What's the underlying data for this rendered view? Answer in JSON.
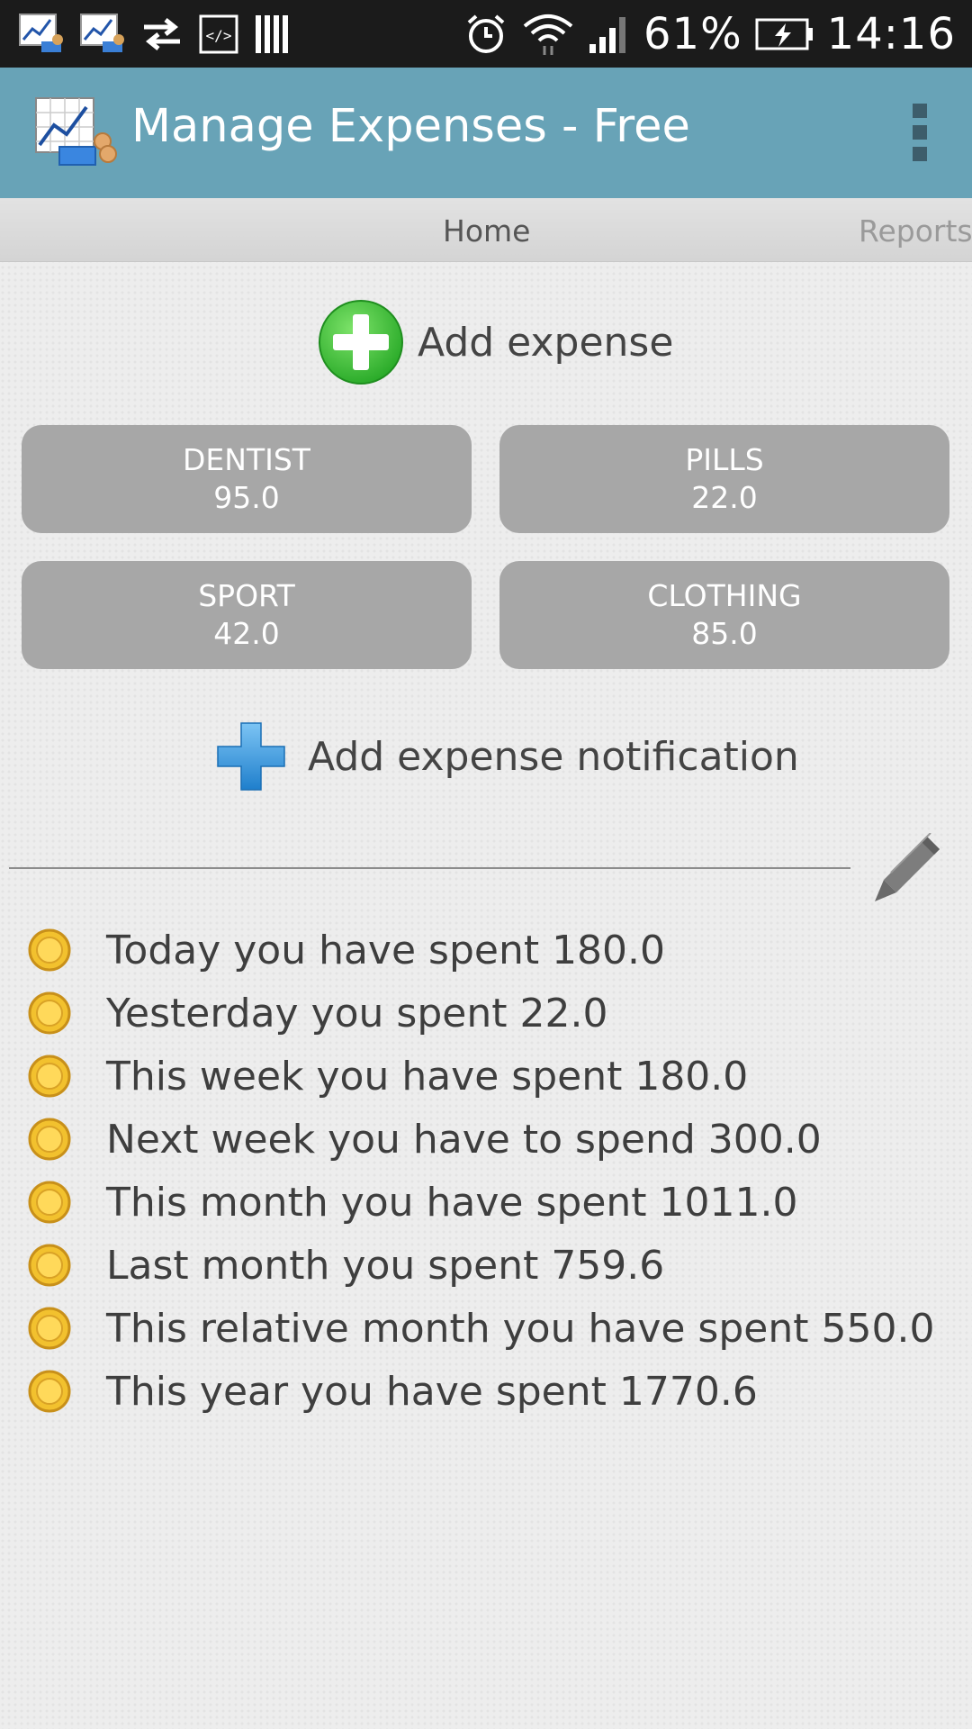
{
  "status_bar": {
    "icons": [
      "chart-app-icon",
      "chart-app-icon",
      "transfer-icon",
      "code-icon",
      "barcode-icon",
      "alarm-icon",
      "wifi-icon",
      "signal-icon",
      "battery-charging-icon"
    ],
    "battery": "61%",
    "time": "14:16"
  },
  "app_bar": {
    "title": "Manage Expenses - Free",
    "menu_icon": "overflow-menu-icon"
  },
  "tabs": [
    {
      "label": "Home"
    },
    {
      "label": "Reports"
    }
  ],
  "add_expense": {
    "label": "Add expense",
    "icon": "green-plus-icon"
  },
  "categories": [
    {
      "name": "DENTIST",
      "value": "95.0"
    },
    {
      "name": "PILLS",
      "value": "22.0"
    },
    {
      "name": "SPORT",
      "value": "42.0"
    },
    {
      "name": "CLOTHING",
      "value": "85.0"
    }
  ],
  "add_notification": {
    "label": "Add expense notification",
    "icon": "blue-plus-icon"
  },
  "edit_icon": "pencil-icon",
  "stats": [
    "Today you have spent 180.0",
    "Yesterday you spent 22.0",
    "This week you have spent 180.0",
    "Next week you have to spend 300.0",
    "This month you have spent 1011.0",
    "Last month you spent 759.6",
    "This relative month you have spent 550.0",
    "This year you have spent 1770.6"
  ],
  "colors": {
    "app_bar": "#68a3b7",
    "status_bar": "#1b1b1b",
    "category_button": "#a7a7a7",
    "add_green": "#3cc43c",
    "notif_blue": "#3b9be0",
    "coin": "#f2c12e"
  }
}
